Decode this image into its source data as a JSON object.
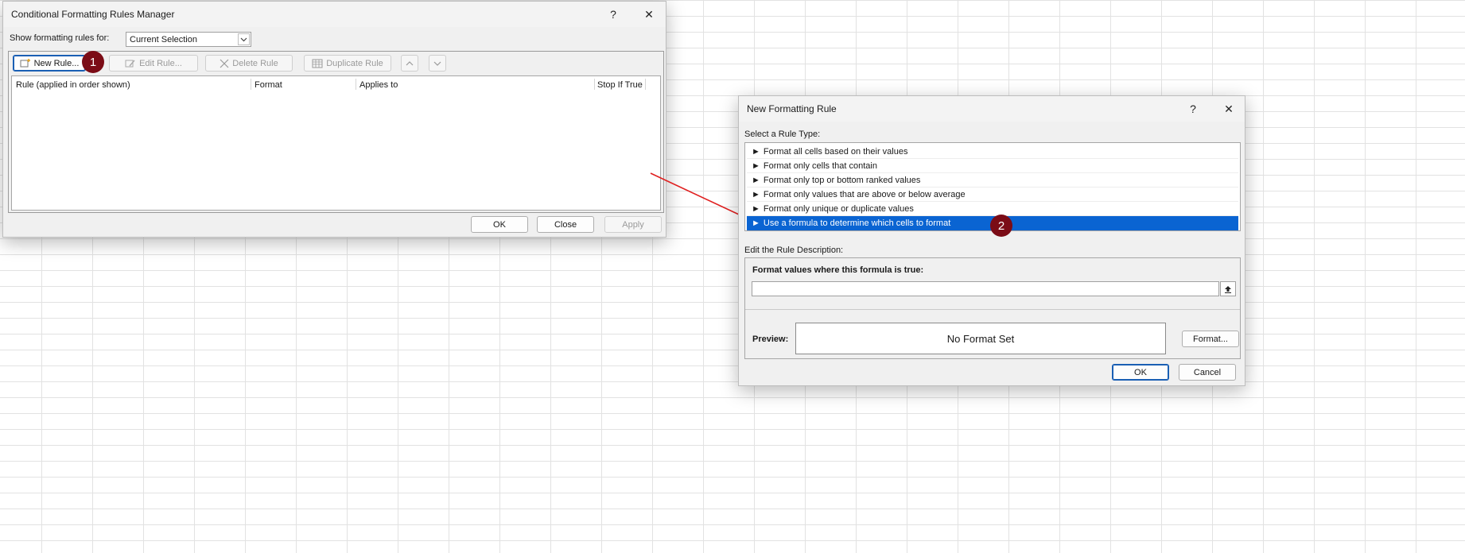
{
  "manager": {
    "title": "Conditional Formatting Rules Manager",
    "help": "?",
    "close": "✕",
    "show_label": "Show formatting rules for:",
    "show_value": "Current Selection",
    "toolbar": {
      "new_rule": "New Rule...",
      "edit_rule": "Edit Rule...",
      "delete_rule": "Delete Rule",
      "duplicate_rule": "Duplicate Rule",
      "up": "▲",
      "down": "▼"
    },
    "columns": [
      "Rule (applied in order shown)",
      "Format",
      "Applies to",
      "Stop If True"
    ],
    "ok": "OK",
    "close_btn": "Close",
    "apply": "Apply"
  },
  "markers": {
    "m1": "1",
    "m2": "2"
  },
  "new_rule": {
    "title": "New Formatting Rule",
    "help": "?",
    "close": "✕",
    "select_label": "Select a Rule Type:",
    "rule_types": [
      "Format all cells based on their values",
      "Format only cells that contain",
      "Format only top or bottom ranked values",
      "Format only values that are above or below average",
      "Format only unique or duplicate values",
      "Use a formula to determine which cells to format"
    ],
    "selected_index": 5,
    "bullet": "►",
    "desc_label": "Edit the Rule Description:",
    "formula_label": "Format values where this formula is true:",
    "formula_value": "",
    "preview_label": "Preview:",
    "preview_text": "No Format Set",
    "format_btn": "Format...",
    "ok": "OK",
    "cancel": "Cancel"
  },
  "colors": {
    "selection": "#0a64d2",
    "marker": "#7b0c16",
    "arrow": "#e02020"
  }
}
